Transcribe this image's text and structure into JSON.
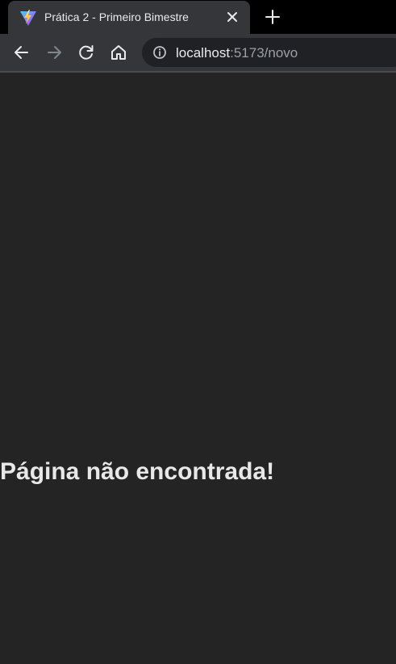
{
  "tab": {
    "title": "Prática 2 - Primeiro Bimestre",
    "favicon": "vite-logo-icon"
  },
  "toolbar": {
    "back_icon": "arrow-left-icon",
    "forward_icon": "arrow-right-icon",
    "reload_icon": "reload-icon",
    "home_icon": "home-icon"
  },
  "address_bar": {
    "host": "localhost",
    "rest": ":5173/novo",
    "info_icon": "info-icon"
  },
  "page": {
    "message": "Página não encontrada!"
  },
  "colors": {
    "page_background": "#242424",
    "tab_background": "#35363a",
    "tab_strip": "#000000",
    "omnibox": "#202124"
  }
}
